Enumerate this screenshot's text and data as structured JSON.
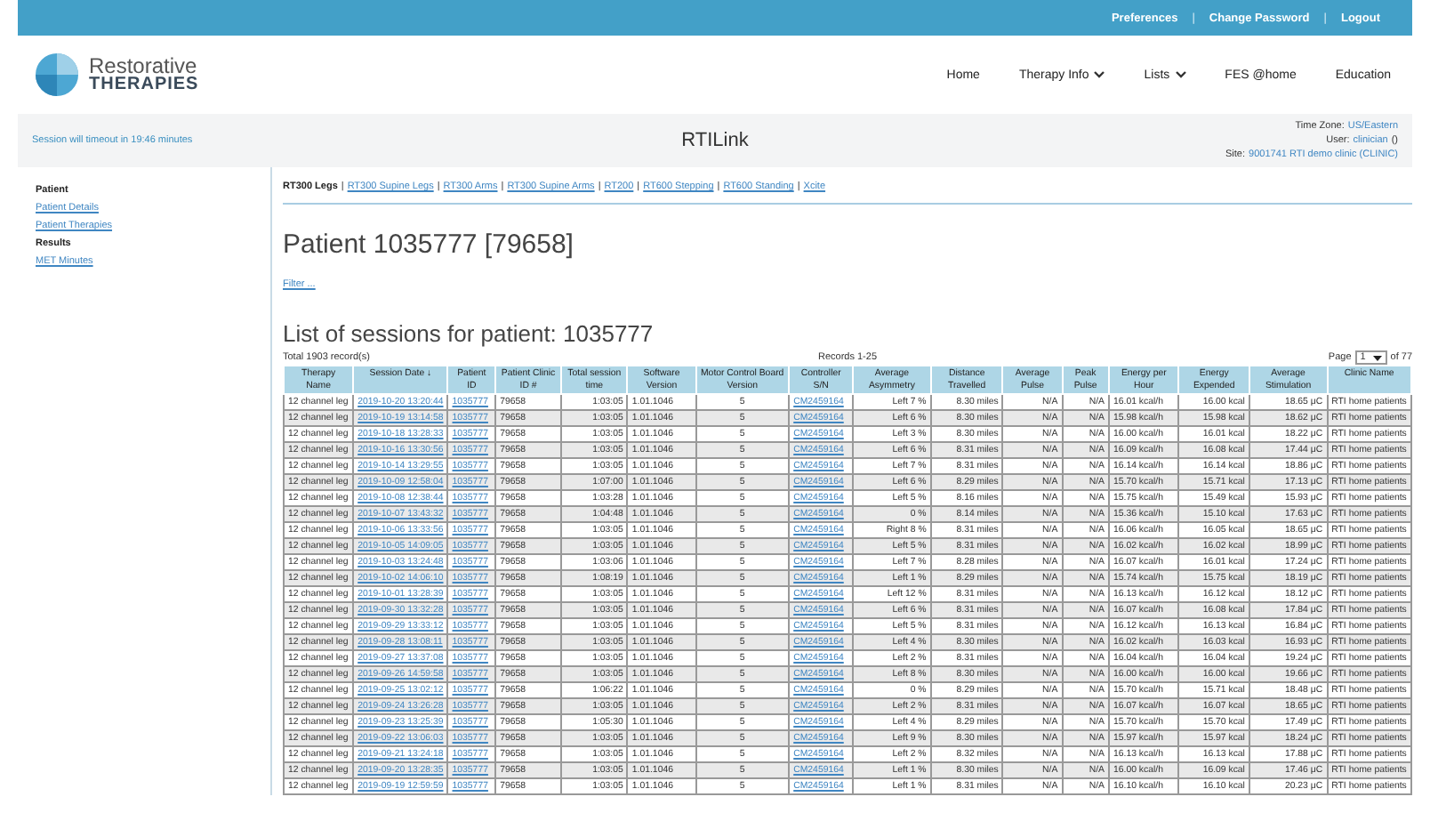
{
  "top_links": [
    "Preferences",
    "Change Password",
    "Logout"
  ],
  "top_links_separator": "|",
  "logo": {
    "line1": "Restorative",
    "line2": "THERAPIES"
  },
  "nav": [
    {
      "label": "Home",
      "dropdown": false
    },
    {
      "label": "Therapy Info",
      "dropdown": true
    },
    {
      "label": "Lists",
      "dropdown": true
    },
    {
      "label": "FES @home",
      "dropdown": false
    },
    {
      "label": "Education",
      "dropdown": false
    }
  ],
  "session_notice": "Session will timeout in 19:46 minutes",
  "app_title": "RTILink",
  "site_info": [
    {
      "label": "Time Zone:",
      "value": "US/Eastern"
    },
    {
      "label": "User:",
      "value": "clinician",
      "suffix": "()"
    },
    {
      "label": "Site:",
      "value": "9001741 RTI demo clinic (CLINIC)"
    }
  ],
  "device_tab_separator": "|",
  "sidebar": [
    {
      "heading": "Patient",
      "items": [
        "Patient Details",
        "Patient Therapies"
      ]
    },
    {
      "heading": "Results",
      "items": [
        "MET Minutes"
      ]
    }
  ],
  "device_tabs": [
    {
      "label": "RT300 Legs",
      "selected": true
    },
    {
      "label": "RT300 Supine Legs",
      "selected": false
    },
    {
      "label": "RT300 Arms",
      "selected": false
    },
    {
      "label": "RT300 Supine Arms",
      "selected": false
    },
    {
      "label": "RT200",
      "selected": false
    },
    {
      "label": "RT600 Stepping",
      "selected": false
    },
    {
      "label": "RT600 Standing",
      "selected": false
    },
    {
      "label": "Xcite",
      "selected": false
    }
  ],
  "patient_title": "Patient 1035777 [79658]",
  "filter_link": "Filter ...",
  "list_title": "List of sessions for patient: 1035777",
  "table": {
    "total": "Total 1903 record(s)",
    "records": "Records 1-25",
    "page_label": "Page",
    "page_value": "1",
    "page_total": "of 77",
    "columns": [
      {
        "label": "Therapy Name",
        "kind": "text"
      },
      {
        "label": "Session Date ↓",
        "kind": "link"
      },
      {
        "label": "Patient ID",
        "kind": "link"
      },
      {
        "label": "Patient Clinic ID #",
        "kind": "text"
      },
      {
        "label": "Total session time",
        "kind": "text"
      },
      {
        "label": "Software Version",
        "kind": "text"
      },
      {
        "label": "Motor Control Board Version",
        "kind": "text"
      },
      {
        "label": "Controller S/N",
        "kind": "link"
      },
      {
        "label": "Average Asymmetry",
        "kind": "text"
      },
      {
        "label": "Distance Travelled",
        "kind": "text"
      },
      {
        "label": "Average Pulse",
        "kind": "text"
      },
      {
        "label": "Peak Pulse",
        "kind": "text"
      },
      {
        "label": "Energy per Hour",
        "kind": "text"
      },
      {
        "label": "Energy Expended",
        "kind": "text"
      },
      {
        "label": "Average Stimulation",
        "kind": "text"
      },
      {
        "label": "Clinic Name",
        "kind": "text"
      }
    ],
    "rows": [
      [
        "12 channel leg",
        "2019-10-20 13:20:44",
        "1035777",
        "79658",
        "1:03:05",
        "1.01.1046",
        "5",
        "CM2459164",
        "Left 7 %",
        "8.30 miles",
        "N/A",
        "N/A",
        "16.01 kcal/h",
        "16.00 kcal",
        "18.65 μC",
        "RTI home patients"
      ],
      [
        "12 channel leg",
        "2019-10-19 13:14:58",
        "1035777",
        "79658",
        "1:03:05",
        "1.01.1046",
        "5",
        "CM2459164",
        "Left 6 %",
        "8.30 miles",
        "N/A",
        "N/A",
        "15.98 kcal/h",
        "15.98 kcal",
        "18.62 μC",
        "RTI home patients"
      ],
      [
        "12 channel leg",
        "2019-10-18 13:28:33",
        "1035777",
        "79658",
        "1:03:05",
        "1.01.1046",
        "5",
        "CM2459164",
        "Left 3 %",
        "8.30 miles",
        "N/A",
        "N/A",
        "16.00 kcal/h",
        "16.01 kcal",
        "18.22 μC",
        "RTI home patients"
      ],
      [
        "12 channel leg",
        "2019-10-16 13:30:56",
        "1035777",
        "79658",
        "1:03:05",
        "1.01.1046",
        "5",
        "CM2459164",
        "Left 6 %",
        "8.31 miles",
        "N/A",
        "N/A",
        "16.09 kcal/h",
        "16.08 kcal",
        "17.44 μC",
        "RTI home patients"
      ],
      [
        "12 channel leg",
        "2019-10-14 13:29:55",
        "1035777",
        "79658",
        "1:03:05",
        "1.01.1046",
        "5",
        "CM2459164",
        "Left 7 %",
        "8.31 miles",
        "N/A",
        "N/A",
        "16.14 kcal/h",
        "16.14 kcal",
        "18.86 μC",
        "RTI home patients"
      ],
      [
        "12 channel leg",
        "2019-10-09 12:58:04",
        "1035777",
        "79658",
        "1:07:00",
        "1.01.1046",
        "5",
        "CM2459164",
        "Left 6 %",
        "8.29 miles",
        "N/A",
        "N/A",
        "15.70 kcal/h",
        "15.71 kcal",
        "17.13 μC",
        "RTI home patients"
      ],
      [
        "12 channel leg",
        "2019-10-08 12:38:44",
        "1035777",
        "79658",
        "1:03:28",
        "1.01.1046",
        "5",
        "CM2459164",
        "Left 5 %",
        "8.16 miles",
        "N/A",
        "N/A",
        "15.75 kcal/h",
        "15.49 kcal",
        "15.93 μC",
        "RTI home patients"
      ],
      [
        "12 channel leg",
        "2019-10-07 13:43:32",
        "1035777",
        "79658",
        "1:04:48",
        "1.01.1046",
        "5",
        "CM2459164",
        "0 %",
        "8.14 miles",
        "N/A",
        "N/A",
        "15.36 kcal/h",
        "15.10 kcal",
        "17.63 μC",
        "RTI home patients"
      ],
      [
        "12 channel leg",
        "2019-10-06 13:33:56",
        "1035777",
        "79658",
        "1:03:05",
        "1.01.1046",
        "5",
        "CM2459164",
        "Right 8 %",
        "8.31 miles",
        "N/A",
        "N/A",
        "16.06 kcal/h",
        "16.05 kcal",
        "18.65 μC",
        "RTI home patients"
      ],
      [
        "12 channel leg",
        "2019-10-05 14:09:05",
        "1035777",
        "79658",
        "1:03:05",
        "1.01.1046",
        "5",
        "CM2459164",
        "Left 5 %",
        "8.31 miles",
        "N/A",
        "N/A",
        "16.02 kcal/h",
        "16.02 kcal",
        "18.99 μC",
        "RTI home patients"
      ],
      [
        "12 channel leg",
        "2019-10-03 13:24:48",
        "1035777",
        "79658",
        "1:03:06",
        "1.01.1046",
        "5",
        "CM2459164",
        "Left 7 %",
        "8.28 miles",
        "N/A",
        "N/A",
        "16.07 kcal/h",
        "16.01 kcal",
        "17.24 μC",
        "RTI home patients"
      ],
      [
        "12 channel leg",
        "2019-10-02 14:06:10",
        "1035777",
        "79658",
        "1:08:19",
        "1.01.1046",
        "5",
        "CM2459164",
        "Left 1 %",
        "8.29 miles",
        "N/A",
        "N/A",
        "15.74 kcal/h",
        "15.75 kcal",
        "18.19 μC",
        "RTI home patients"
      ],
      [
        "12 channel leg",
        "2019-10-01 13:28:39",
        "1035777",
        "79658",
        "1:03:05",
        "1.01.1046",
        "5",
        "CM2459164",
        "Left 12 %",
        "8.31 miles",
        "N/A",
        "N/A",
        "16.13 kcal/h",
        "16.12 kcal",
        "18.12 μC",
        "RTI home patients"
      ],
      [
        "12 channel leg",
        "2019-09-30 13:32:28",
        "1035777",
        "79658",
        "1:03:05",
        "1.01.1046",
        "5",
        "CM2459164",
        "Left 6 %",
        "8.31 miles",
        "N/A",
        "N/A",
        "16.07 kcal/h",
        "16.08 kcal",
        "17.84 μC",
        "RTI home patients"
      ],
      [
        "12 channel leg",
        "2019-09-29 13:33:12",
        "1035777",
        "79658",
        "1:03:05",
        "1.01.1046",
        "5",
        "CM2459164",
        "Left 5 %",
        "8.31 miles",
        "N/A",
        "N/A",
        "16.12 kcal/h",
        "16.13 kcal",
        "16.84 μC",
        "RTI home patients"
      ],
      [
        "12 channel leg",
        "2019-09-28 13:08:11",
        "1035777",
        "79658",
        "1:03:05",
        "1.01.1046",
        "5",
        "CM2459164",
        "Left 4 %",
        "8.30 miles",
        "N/A",
        "N/A",
        "16.02 kcal/h",
        "16.03 kcal",
        "16.93 μC",
        "RTI home patients"
      ],
      [
        "12 channel leg",
        "2019-09-27 13:37:08",
        "1035777",
        "79658",
        "1:03:05",
        "1.01.1046",
        "5",
        "CM2459164",
        "Left 2 %",
        "8.31 miles",
        "N/A",
        "N/A",
        "16.04 kcal/h",
        "16.04 kcal",
        "19.24 μC",
        "RTI home patients"
      ],
      [
        "12 channel leg",
        "2019-09-26 14:59:58",
        "1035777",
        "79658",
        "1:03:05",
        "1.01.1046",
        "5",
        "CM2459164",
        "Left 8 %",
        "8.30 miles",
        "N/A",
        "N/A",
        "16.00 kcal/h",
        "16.00 kcal",
        "19.66 μC",
        "RTI home patients"
      ],
      [
        "12 channel leg",
        "2019-09-25 13:02:12",
        "1035777",
        "79658",
        "1:06:22",
        "1.01.1046",
        "5",
        "CM2459164",
        "0 %",
        "8.29 miles",
        "N/A",
        "N/A",
        "15.70 kcal/h",
        "15.71 kcal",
        "18.48 μC",
        "RTI home patients"
      ],
      [
        "12 channel leg",
        "2019-09-24 13:26:28",
        "1035777",
        "79658",
        "1:03:05",
        "1.01.1046",
        "5",
        "CM2459164",
        "Left 2 %",
        "8.31 miles",
        "N/A",
        "N/A",
        "16.07 kcal/h",
        "16.07 kcal",
        "18.65 μC",
        "RTI home patients"
      ],
      [
        "12 channel leg",
        "2019-09-23 13:25:39",
        "1035777",
        "79658",
        "1:05:30",
        "1.01.1046",
        "5",
        "CM2459164",
        "Left 4 %",
        "8.29 miles",
        "N/A",
        "N/A",
        "15.70 kcal/h",
        "15.70 kcal",
        "17.49 μC",
        "RTI home patients"
      ],
      [
        "12 channel leg",
        "2019-09-22 13:06:03",
        "1035777",
        "79658",
        "1:03:05",
        "1.01.1046",
        "5",
        "CM2459164",
        "Left 9 %",
        "8.30 miles",
        "N/A",
        "N/A",
        "15.97 kcal/h",
        "15.97 kcal",
        "18.24 μC",
        "RTI home patients"
      ],
      [
        "12 channel leg",
        "2019-09-21 13:24:18",
        "1035777",
        "79658",
        "1:03:05",
        "1.01.1046",
        "5",
        "CM2459164",
        "Left 2 %",
        "8.32 miles",
        "N/A",
        "N/A",
        "16.13 kcal/h",
        "16.13 kcal",
        "17.88 μC",
        "RTI home patients"
      ],
      [
        "12 channel leg",
        "2019-09-20 13:28:35",
        "1035777",
        "79658",
        "1:03:05",
        "1.01.1046",
        "5",
        "CM2459164",
        "Left 1 %",
        "8.30 miles",
        "N/A",
        "N/A",
        "16.00 kcal/h",
        "16.09 kcal",
        "17.46 μC",
        "RTI home patients"
      ],
      [
        "12 channel leg",
        "2019-09-19 12:59:59",
        "1035777",
        "79658",
        "1:03:05",
        "1.01.1046",
        "5",
        "CM2459164",
        "Left 1 %",
        "8.31 miles",
        "N/A",
        "N/A",
        "16.10 kcal/h",
        "16.10 kcal",
        "20.23 μC",
        "RTI home patients"
      ]
    ]
  }
}
